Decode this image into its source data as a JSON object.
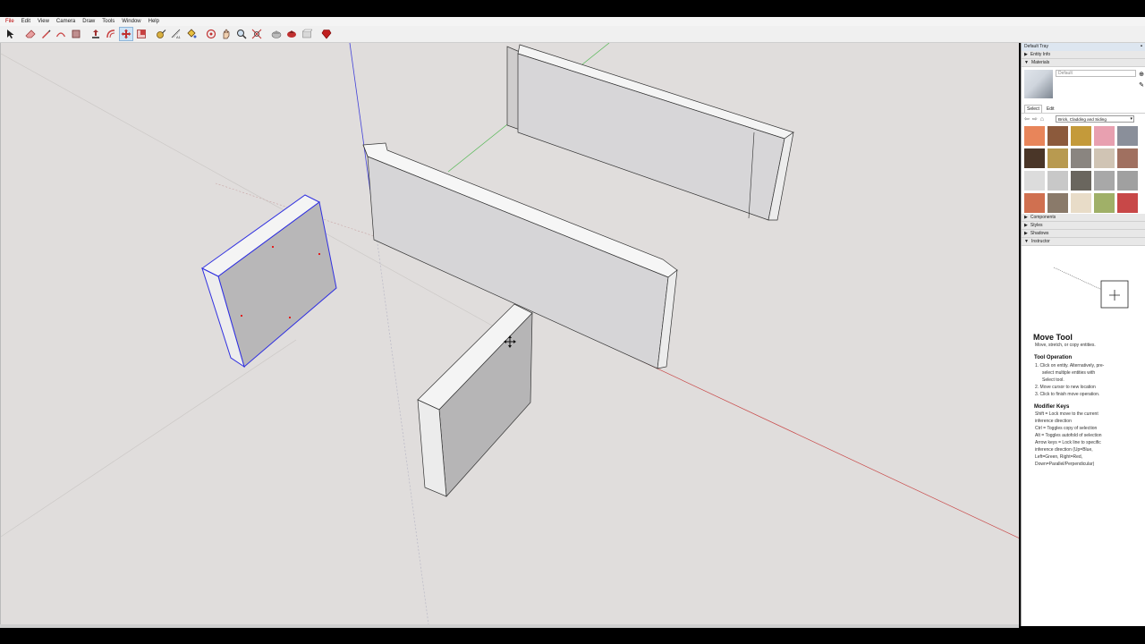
{
  "menu": [
    "File",
    "Edit",
    "View",
    "Camera",
    "Draw",
    "Tools",
    "Window",
    "Help"
  ],
  "toolbar": [
    {
      "icon": "select-arrow-icon"
    },
    {
      "icon": "eraser-icon"
    },
    {
      "icon": "pencil-line-icon"
    },
    {
      "icon": "arc-icon"
    },
    {
      "icon": "rectangle-icon"
    },
    {
      "icon": "push-pull-icon"
    },
    {
      "icon": "offset-icon"
    },
    {
      "icon": "move-icon",
      "active": true
    },
    {
      "icon": "scale-icon"
    },
    {
      "icon": "tape-measure-icon"
    },
    {
      "icon": "dimension-icon"
    },
    {
      "icon": "paint-bucket-icon"
    },
    {
      "icon": "orbit-icon"
    },
    {
      "icon": "pan-icon"
    },
    {
      "icon": "zoom-icon"
    },
    {
      "icon": "zoom-extents-icon"
    },
    {
      "icon": "warehouse-icon"
    },
    {
      "icon": "share-model-icon"
    },
    {
      "icon": "components-icon"
    },
    {
      "icon": "extension-ruby-icon"
    }
  ],
  "tray": {
    "title": "Default Tray",
    "panels": {
      "entity_info": "Entity Info",
      "materials": "Materials",
      "components": "Components",
      "styles": "Styles",
      "shadows": "Shadows",
      "instructor": "Instructor"
    },
    "material_name": "Default",
    "tabs": [
      "Select",
      "Edit"
    ],
    "collection": "Brick, Cladding and Siding",
    "swatch_colors": [
      "#e8855a",
      "#8c5a3c",
      "#c49a3a",
      "#e8a0b0",
      "#8a8f9a",
      "#4a3628",
      "#b89a50",
      "#8a8580",
      "#d0c4b4",
      "#a07060",
      "#dcdcdc",
      "#c8c8c8",
      "#6a665e",
      "#a8a8a8",
      "#a0a0a0",
      "#d07050",
      "#8a7a6a",
      "#e8dcc8",
      "#a0b068",
      "#c84848"
    ]
  },
  "instructor": {
    "title": "Move Tool",
    "subtitle": "Move, stretch, or copy entities.",
    "op_heading": "Tool Operation",
    "op_lines": [
      "1. Click on entity. Alternatively, pre-",
      "select multiple entities with",
      "Select tool.",
      "2. Move cursor to new location",
      "3. Click to finish move operation."
    ],
    "mod_heading": "Modifier Keys",
    "mod_lines": [
      "Shift = Lock move to the current",
      "inference direction",
      "Ctrl = Toggles copy of selection",
      "Alt = Toggles autofold of selection",
      "Arrow keys = Lock line to specific",
      "inference direction (Up=Blue,",
      "Left=Green, Right=Red,",
      "Down=Parallel/Perpendicular)"
    ]
  }
}
